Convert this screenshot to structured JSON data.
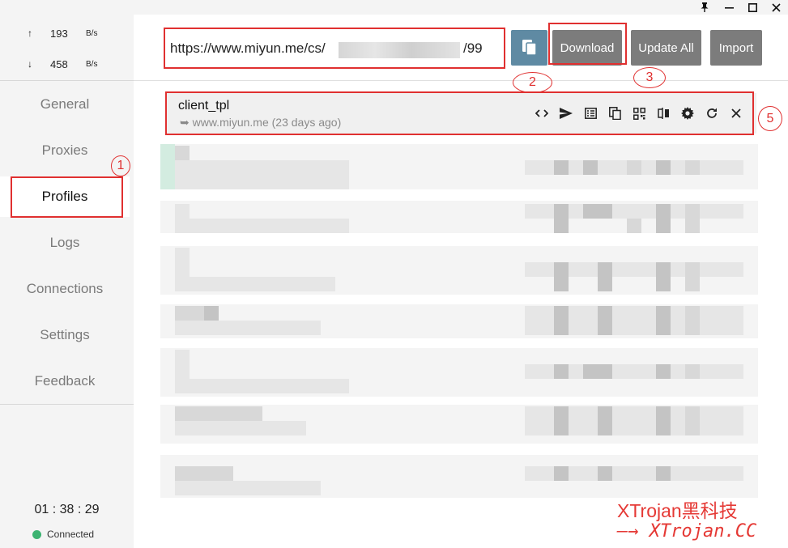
{
  "window": {
    "pin": "📌",
    "minimize": "—",
    "maximize": "☐",
    "close": "✕"
  },
  "speed": {
    "up": {
      "arrow": "↑",
      "value": "193",
      "unit": "B/s"
    },
    "down": {
      "arrow": "↓",
      "value": "458",
      "unit": "B/s"
    }
  },
  "sidebar": {
    "items": [
      {
        "label": "General"
      },
      {
        "label": "Proxies"
      },
      {
        "label": "Profiles"
      },
      {
        "label": "Logs"
      },
      {
        "label": "Connections"
      },
      {
        "label": "Settings"
      },
      {
        "label": "Feedback"
      }
    ],
    "active": "Profiles"
  },
  "footer": {
    "clock": "01 : 38 : 29",
    "status": "Connected",
    "status_color": "#3cb371"
  },
  "toolbar": {
    "url_value": "https://www.miyun.me/cs/",
    "url_tail": "/99",
    "copy_icon": "copy-icon",
    "download_label": "Download",
    "update_all_label": "Update All",
    "import_label": "Import"
  },
  "profile": {
    "name": "client_tpl",
    "source": "➥ www.miyun.me (23 days ago)",
    "icons": [
      "code-icon",
      "send-icon",
      "list-icon",
      "copy-icon",
      "qrcode-icon",
      "compare-icon",
      "gear-icon",
      "refresh-icon",
      "close-icon"
    ]
  },
  "annotations": [
    "1",
    "2",
    "3",
    "5"
  ],
  "watermark": {
    "line1": "XTrojan黑科技",
    "line2": "—→ XTrojan.CC"
  },
  "colors": {
    "accent_copy": "#5f8aa3",
    "button": "#7c7c7c",
    "annotation": "#e03030",
    "watermark": "#e53935"
  }
}
